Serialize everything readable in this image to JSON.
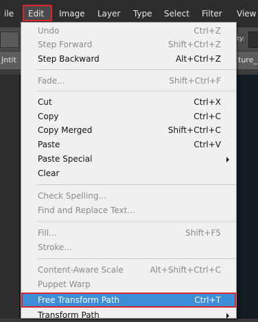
{
  "menubar": {
    "items": [
      "ile",
      "Edit",
      "Image",
      "Layer",
      "Type",
      "Select",
      "Filter",
      "View"
    ]
  },
  "options_bar": {
    "partial_label": "ity:"
  },
  "tabs": {
    "left_partial": "Jntit",
    "right_partial": "ture_"
  },
  "edit_menu": {
    "items": [
      {
        "label": "Undo",
        "shortcut": "Ctrl+Z",
        "enabled": false
      },
      {
        "label": "Step Forward",
        "shortcut": "Shift+Ctrl+Z",
        "enabled": false
      },
      {
        "label": "Step Backward",
        "shortcut": "Alt+Ctrl+Z",
        "enabled": true
      },
      {
        "label": "Fade...",
        "shortcut": "Shift+Ctrl+F",
        "enabled": false
      },
      {
        "label": "Cut",
        "shortcut": "Ctrl+X",
        "enabled": true
      },
      {
        "label": "Copy",
        "shortcut": "Ctrl+C",
        "enabled": true
      },
      {
        "label": "Copy Merged",
        "shortcut": "Shift+Ctrl+C",
        "enabled": true
      },
      {
        "label": "Paste",
        "shortcut": "Ctrl+V",
        "enabled": true
      },
      {
        "label": "Paste Special",
        "shortcut": "",
        "enabled": true,
        "submenu": true
      },
      {
        "label": "Clear",
        "shortcut": "",
        "enabled": true
      },
      {
        "label": "Check Spelling...",
        "shortcut": "",
        "enabled": false
      },
      {
        "label": "Find and Replace Text...",
        "shortcut": "",
        "enabled": false
      },
      {
        "label": "Fill...",
        "shortcut": "Shift+F5",
        "enabled": false
      },
      {
        "label": "Stroke...",
        "shortcut": "",
        "enabled": false
      },
      {
        "label": "Content-Aware Scale",
        "shortcut": "Alt+Shift+Ctrl+C",
        "enabled": false
      },
      {
        "label": "Puppet Warp",
        "shortcut": "",
        "enabled": false
      },
      {
        "label": "Free Transform Path",
        "shortcut": "Ctrl+T",
        "enabled": true,
        "highlighted": true
      },
      {
        "label": "Transform Path",
        "shortcut": "",
        "enabled": true,
        "submenu": true
      }
    ]
  },
  "colors": {
    "menubar_bg": "#2d2d2d",
    "menu_bg": "#f0f0f0",
    "highlight": "#3d8ed9",
    "annotation_red": "#d9242b",
    "disabled_text": "#8a8a8a"
  }
}
